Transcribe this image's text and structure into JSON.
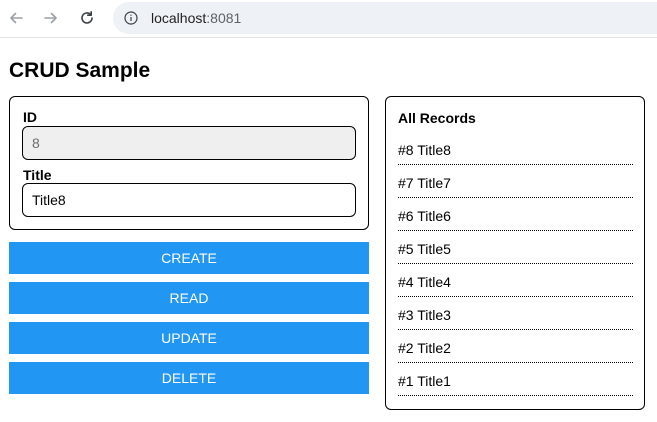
{
  "browser": {
    "url_host": "localhost",
    "url_port": ":8081"
  },
  "page": {
    "title": "CRUD Sample"
  },
  "form": {
    "id_label": "ID",
    "id_value": "8",
    "title_label": "Title",
    "title_value": "Title8"
  },
  "actions": {
    "create": "CREATE",
    "read": "READ",
    "update": "UPDATE",
    "delete": "DELETE"
  },
  "records": {
    "heading": "All Records",
    "items": [
      "#8 Title8",
      "#7 Title7",
      "#6 Title6",
      "#5 Title5",
      "#4 Title4",
      "#3 Title3",
      "#2 Title2",
      "#1 Title1"
    ]
  },
  "colors": {
    "button_bg": "#2196f3",
    "url_bar_bg": "#eef1f6"
  }
}
